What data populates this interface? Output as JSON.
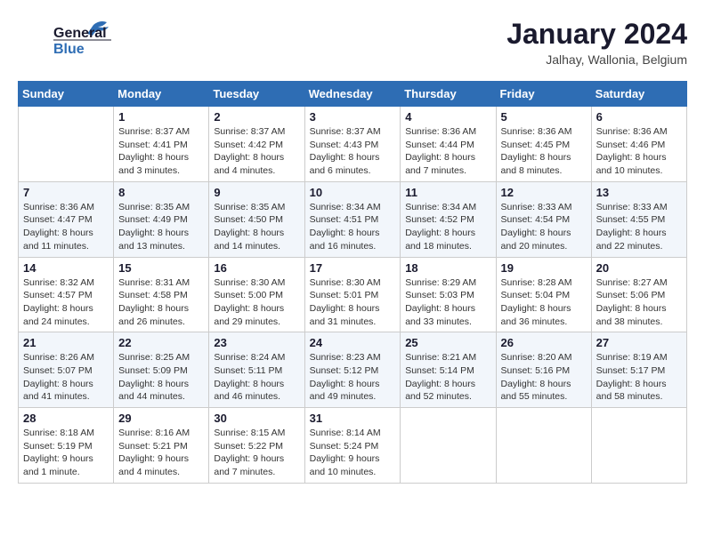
{
  "logo": {
    "line1": "General",
    "line2": "Blue"
  },
  "title": "January 2024",
  "location": "Jalhay, Wallonia, Belgium",
  "weekdays": [
    "Sunday",
    "Monday",
    "Tuesday",
    "Wednesday",
    "Thursday",
    "Friday",
    "Saturday"
  ],
  "weeks": [
    [
      {
        "day": "",
        "sunrise": "",
        "sunset": "",
        "daylight": ""
      },
      {
        "day": "1",
        "sunrise": "Sunrise: 8:37 AM",
        "sunset": "Sunset: 4:41 PM",
        "daylight": "Daylight: 8 hours and 3 minutes."
      },
      {
        "day": "2",
        "sunrise": "Sunrise: 8:37 AM",
        "sunset": "Sunset: 4:42 PM",
        "daylight": "Daylight: 8 hours and 4 minutes."
      },
      {
        "day": "3",
        "sunrise": "Sunrise: 8:37 AM",
        "sunset": "Sunset: 4:43 PM",
        "daylight": "Daylight: 8 hours and 6 minutes."
      },
      {
        "day": "4",
        "sunrise": "Sunrise: 8:36 AM",
        "sunset": "Sunset: 4:44 PM",
        "daylight": "Daylight: 8 hours and 7 minutes."
      },
      {
        "day": "5",
        "sunrise": "Sunrise: 8:36 AM",
        "sunset": "Sunset: 4:45 PM",
        "daylight": "Daylight: 8 hours and 8 minutes."
      },
      {
        "day": "6",
        "sunrise": "Sunrise: 8:36 AM",
        "sunset": "Sunset: 4:46 PM",
        "daylight": "Daylight: 8 hours and 10 minutes."
      }
    ],
    [
      {
        "day": "7",
        "sunrise": "Sunrise: 8:36 AM",
        "sunset": "Sunset: 4:47 PM",
        "daylight": "Daylight: 8 hours and 11 minutes."
      },
      {
        "day": "8",
        "sunrise": "Sunrise: 8:35 AM",
        "sunset": "Sunset: 4:49 PM",
        "daylight": "Daylight: 8 hours and 13 minutes."
      },
      {
        "day": "9",
        "sunrise": "Sunrise: 8:35 AM",
        "sunset": "Sunset: 4:50 PM",
        "daylight": "Daylight: 8 hours and 14 minutes."
      },
      {
        "day": "10",
        "sunrise": "Sunrise: 8:34 AM",
        "sunset": "Sunset: 4:51 PM",
        "daylight": "Daylight: 8 hours and 16 minutes."
      },
      {
        "day": "11",
        "sunrise": "Sunrise: 8:34 AM",
        "sunset": "Sunset: 4:52 PM",
        "daylight": "Daylight: 8 hours and 18 minutes."
      },
      {
        "day": "12",
        "sunrise": "Sunrise: 8:33 AM",
        "sunset": "Sunset: 4:54 PM",
        "daylight": "Daylight: 8 hours and 20 minutes."
      },
      {
        "day": "13",
        "sunrise": "Sunrise: 8:33 AM",
        "sunset": "Sunset: 4:55 PM",
        "daylight": "Daylight: 8 hours and 22 minutes."
      }
    ],
    [
      {
        "day": "14",
        "sunrise": "Sunrise: 8:32 AM",
        "sunset": "Sunset: 4:57 PM",
        "daylight": "Daylight: 8 hours and 24 minutes."
      },
      {
        "day": "15",
        "sunrise": "Sunrise: 8:31 AM",
        "sunset": "Sunset: 4:58 PM",
        "daylight": "Daylight: 8 hours and 26 minutes."
      },
      {
        "day": "16",
        "sunrise": "Sunrise: 8:30 AM",
        "sunset": "Sunset: 5:00 PM",
        "daylight": "Daylight: 8 hours and 29 minutes."
      },
      {
        "day": "17",
        "sunrise": "Sunrise: 8:30 AM",
        "sunset": "Sunset: 5:01 PM",
        "daylight": "Daylight: 8 hours and 31 minutes."
      },
      {
        "day": "18",
        "sunrise": "Sunrise: 8:29 AM",
        "sunset": "Sunset: 5:03 PM",
        "daylight": "Daylight: 8 hours and 33 minutes."
      },
      {
        "day": "19",
        "sunrise": "Sunrise: 8:28 AM",
        "sunset": "Sunset: 5:04 PM",
        "daylight": "Daylight: 8 hours and 36 minutes."
      },
      {
        "day": "20",
        "sunrise": "Sunrise: 8:27 AM",
        "sunset": "Sunset: 5:06 PM",
        "daylight": "Daylight: 8 hours and 38 minutes."
      }
    ],
    [
      {
        "day": "21",
        "sunrise": "Sunrise: 8:26 AM",
        "sunset": "Sunset: 5:07 PM",
        "daylight": "Daylight: 8 hours and 41 minutes."
      },
      {
        "day": "22",
        "sunrise": "Sunrise: 8:25 AM",
        "sunset": "Sunset: 5:09 PM",
        "daylight": "Daylight: 8 hours and 44 minutes."
      },
      {
        "day": "23",
        "sunrise": "Sunrise: 8:24 AM",
        "sunset": "Sunset: 5:11 PM",
        "daylight": "Daylight: 8 hours and 46 minutes."
      },
      {
        "day": "24",
        "sunrise": "Sunrise: 8:23 AM",
        "sunset": "Sunset: 5:12 PM",
        "daylight": "Daylight: 8 hours and 49 minutes."
      },
      {
        "day": "25",
        "sunrise": "Sunrise: 8:21 AM",
        "sunset": "Sunset: 5:14 PM",
        "daylight": "Daylight: 8 hours and 52 minutes."
      },
      {
        "day": "26",
        "sunrise": "Sunrise: 8:20 AM",
        "sunset": "Sunset: 5:16 PM",
        "daylight": "Daylight: 8 hours and 55 minutes."
      },
      {
        "day": "27",
        "sunrise": "Sunrise: 8:19 AM",
        "sunset": "Sunset: 5:17 PM",
        "daylight": "Daylight: 8 hours and 58 minutes."
      }
    ],
    [
      {
        "day": "28",
        "sunrise": "Sunrise: 8:18 AM",
        "sunset": "Sunset: 5:19 PM",
        "daylight": "Daylight: 9 hours and 1 minute."
      },
      {
        "day": "29",
        "sunrise": "Sunrise: 8:16 AM",
        "sunset": "Sunset: 5:21 PM",
        "daylight": "Daylight: 9 hours and 4 minutes."
      },
      {
        "day": "30",
        "sunrise": "Sunrise: 8:15 AM",
        "sunset": "Sunset: 5:22 PM",
        "daylight": "Daylight: 9 hours and 7 minutes."
      },
      {
        "day": "31",
        "sunrise": "Sunrise: 8:14 AM",
        "sunset": "Sunset: 5:24 PM",
        "daylight": "Daylight: 9 hours and 10 minutes."
      },
      {
        "day": "",
        "sunrise": "",
        "sunset": "",
        "daylight": ""
      },
      {
        "day": "",
        "sunrise": "",
        "sunset": "",
        "daylight": ""
      },
      {
        "day": "",
        "sunrise": "",
        "sunset": "",
        "daylight": ""
      }
    ]
  ]
}
